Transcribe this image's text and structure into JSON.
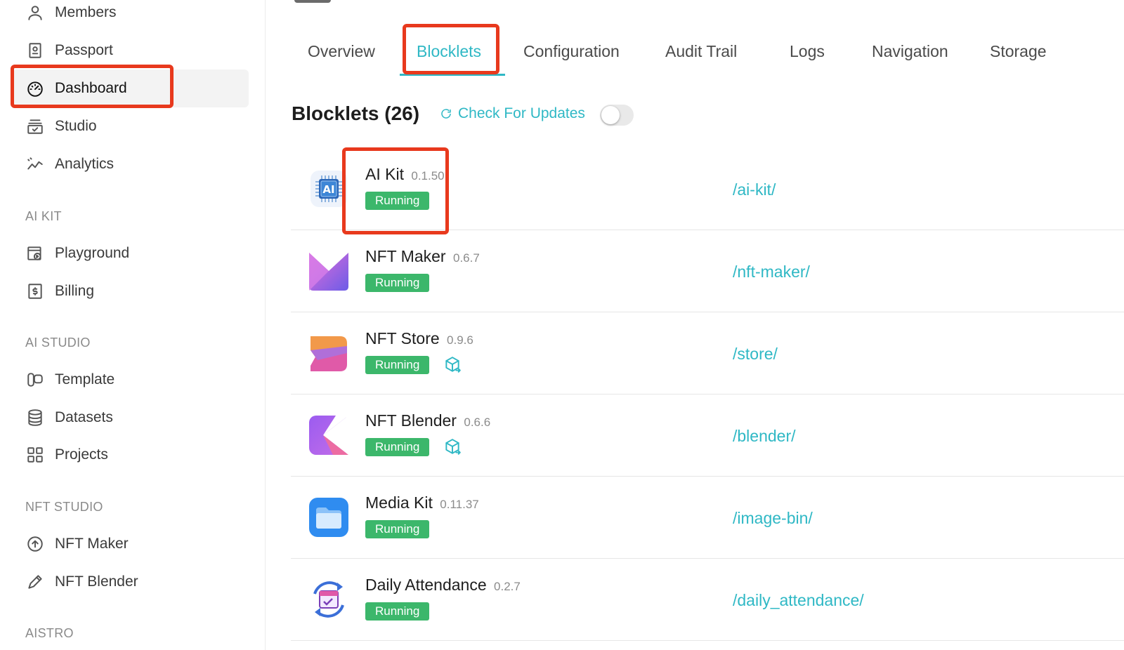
{
  "sidebar": {
    "items": [
      {
        "label": "Members",
        "icon": "user-icon"
      },
      {
        "label": "Passport",
        "icon": "passport-icon"
      },
      {
        "label": "Dashboard",
        "icon": "dashboard-icon",
        "active": true
      },
      {
        "label": "Studio",
        "icon": "studio-icon"
      },
      {
        "label": "Analytics",
        "icon": "analytics-icon"
      }
    ],
    "sections": [
      {
        "title": "AI KIT",
        "items": [
          {
            "label": "Playground",
            "icon": "playground-icon"
          },
          {
            "label": "Billing",
            "icon": "billing-icon"
          }
        ]
      },
      {
        "title": "AI STUDIO",
        "items": [
          {
            "label": "Template",
            "icon": "template-icon"
          },
          {
            "label": "Datasets",
            "icon": "datasets-icon"
          },
          {
            "label": "Projects",
            "icon": "projects-icon"
          }
        ]
      },
      {
        "title": "NFT STUDIO",
        "items": [
          {
            "label": "NFT Maker",
            "icon": "upload-circle-icon"
          },
          {
            "label": "NFT Blender",
            "icon": "pen-icon"
          }
        ]
      },
      {
        "title": "AISTRO",
        "items": []
      }
    ]
  },
  "tabs": [
    {
      "label": "Overview"
    },
    {
      "label": "Blocklets",
      "active": true
    },
    {
      "label": "Configuration"
    },
    {
      "label": "Audit Trail"
    },
    {
      "label": "Logs"
    },
    {
      "label": "Navigation"
    },
    {
      "label": "Storage"
    }
  ],
  "blocklets": {
    "title": "Blocklets (26)",
    "check_updates_label": "Check For Updates",
    "auto_update_enabled": false,
    "rows": [
      {
        "name": "AI Kit",
        "version": "0.1.50",
        "status": "Running",
        "path": "/ai-kit/",
        "logo": "ai-chip-logo",
        "has_update_icon": false
      },
      {
        "name": "NFT Maker",
        "version": "0.6.7",
        "status": "Running",
        "path": "/nft-maker/",
        "logo": "nft-maker-logo",
        "has_update_icon": false
      },
      {
        "name": "NFT Store",
        "version": "0.9.6",
        "status": "Running",
        "path": "/store/",
        "logo": "nft-store-logo",
        "has_update_icon": true
      },
      {
        "name": "NFT Blender",
        "version": "0.6.6",
        "status": "Running",
        "path": "/blender/",
        "logo": "nft-blender-logo",
        "has_update_icon": true
      },
      {
        "name": "Media Kit",
        "version": "0.11.37",
        "status": "Running",
        "path": "/image-bin/",
        "logo": "media-kit-logo",
        "has_update_icon": false
      },
      {
        "name": "Daily Attendance",
        "version": "0.2.7",
        "status": "Running",
        "path": "/daily_attendance/",
        "logo": "daily-attendance-logo",
        "has_update_icon": false
      }
    ]
  },
  "colors": {
    "accent": "#2fb8c5",
    "running_badge": "#3cb76b",
    "highlight_box": "#e8391d"
  }
}
